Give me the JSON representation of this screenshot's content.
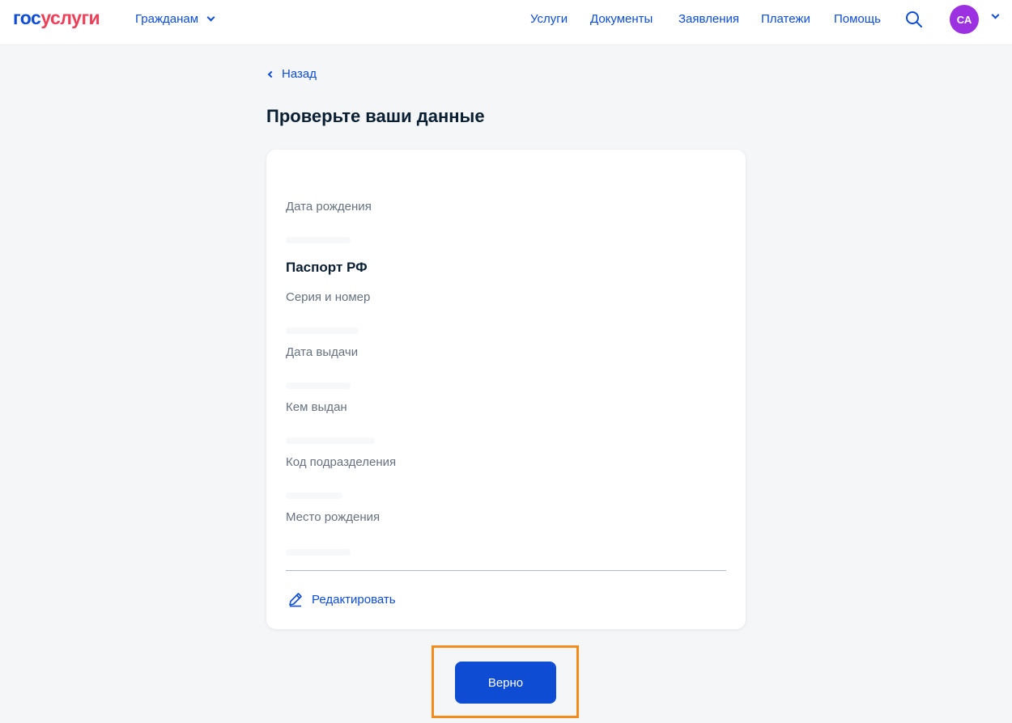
{
  "header": {
    "logo_part1": "гос",
    "logo_part2": "услуги",
    "audience": "Гражданам",
    "nav": [
      "Услуги",
      "Документы",
      "Заявления",
      "Платежи",
      "Помощь"
    ],
    "avatar_initials": "СА"
  },
  "back_label": "Назад",
  "page_title": "Проверьте ваши данные",
  "card": {
    "birth_date_label": "Дата рождения",
    "passport_title": "Паспорт РФ",
    "fields": [
      "Серия и номер",
      "Дата выдачи",
      "Кем выдан",
      "Код подразделения",
      "Место рождения"
    ],
    "edit_label": "Редактировать"
  },
  "confirm_label": "Верно",
  "colors": {
    "brand_blue": "#0d4cd3",
    "brand_red": "#ee3f58",
    "avatar": "#9b31e0",
    "highlight": "#f28c1b"
  }
}
